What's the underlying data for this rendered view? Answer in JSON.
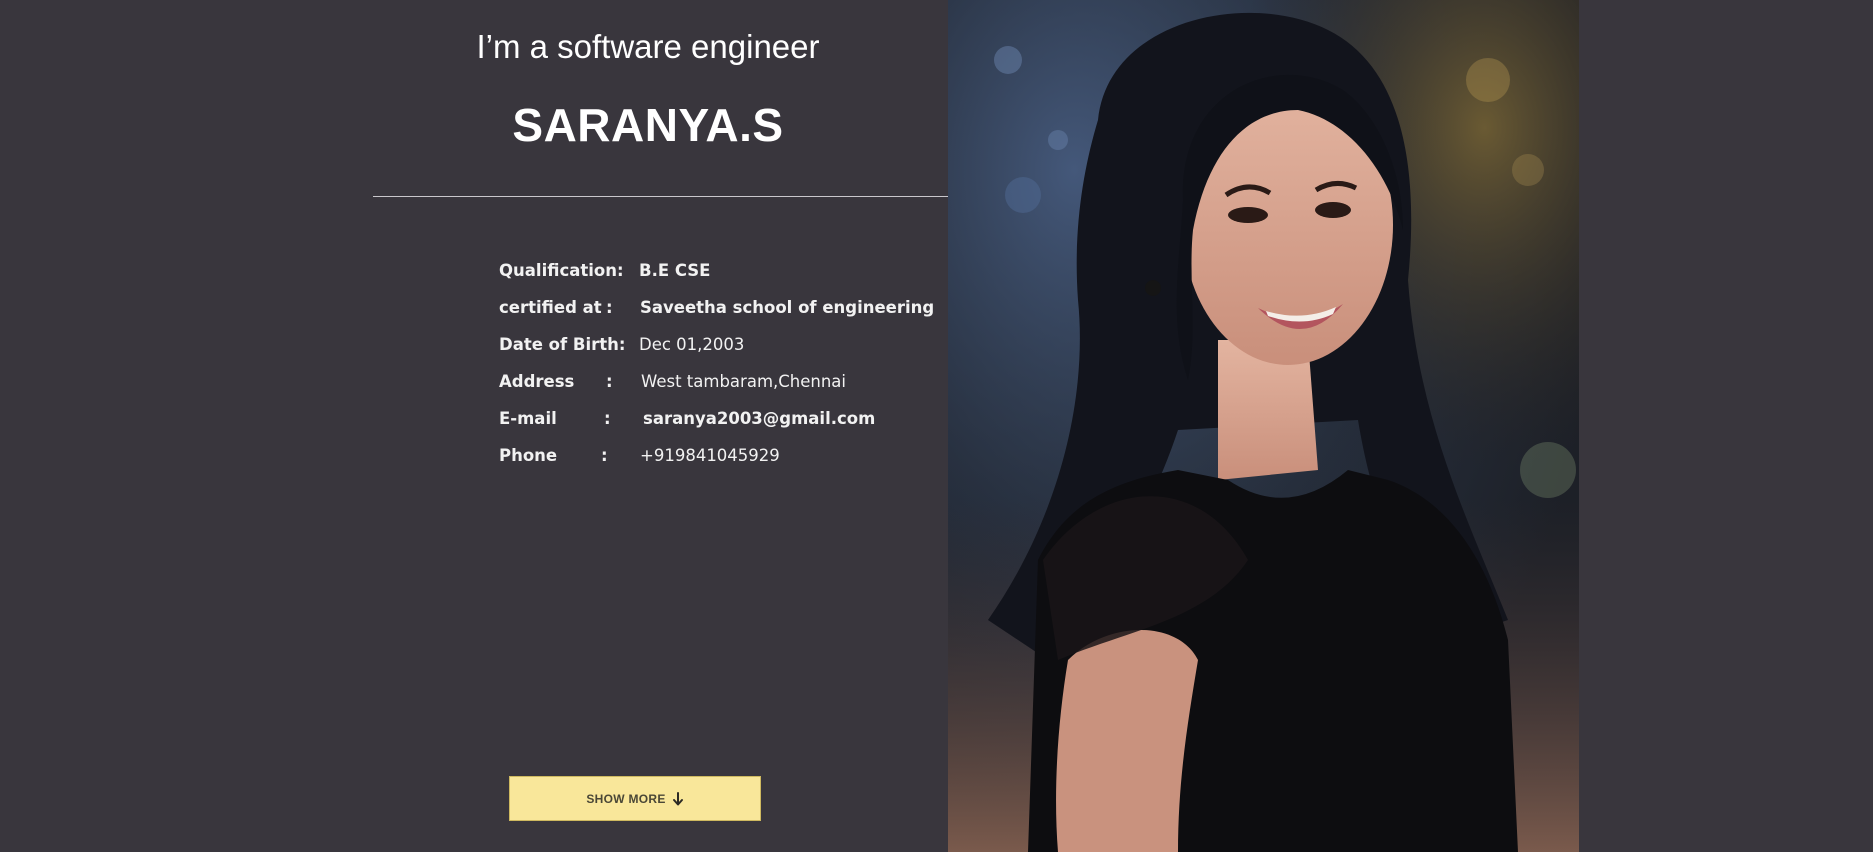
{
  "profile": {
    "intro": "I’m a software engineer",
    "name": "SARANYA.S"
  },
  "details": [
    {
      "label": "Qualification:",
      "colon": "",
      "value": "B.E CSE",
      "bold": true
    },
    {
      "label": "certified at",
      "colon": ":",
      "value": "Saveetha school of engineering",
      "bold": true
    },
    {
      "label": "Date of Birth:",
      "colon": "",
      "value": "Dec 01,2003",
      "bold": false
    },
    {
      "label": "Address",
      "colon": ":",
      "value": "West tambaram,Chennai",
      "bold": false
    },
    {
      "label": "E-mail",
      "colon": ":",
      "value": "saranya2003@gmail.com",
      "bold": true
    },
    {
      "label": "Phone",
      "colon": ":",
      "value": "+919841045929",
      "bold": false
    }
  ],
  "actions": {
    "show_more_label": "SHOW MORE",
    "show_more_icon": "arrow-down-icon"
  },
  "colors": {
    "background": "#39363d",
    "button": "#f9e79a",
    "text": "#ffffff"
  },
  "portrait": {
    "icon": "portrait-photo"
  }
}
